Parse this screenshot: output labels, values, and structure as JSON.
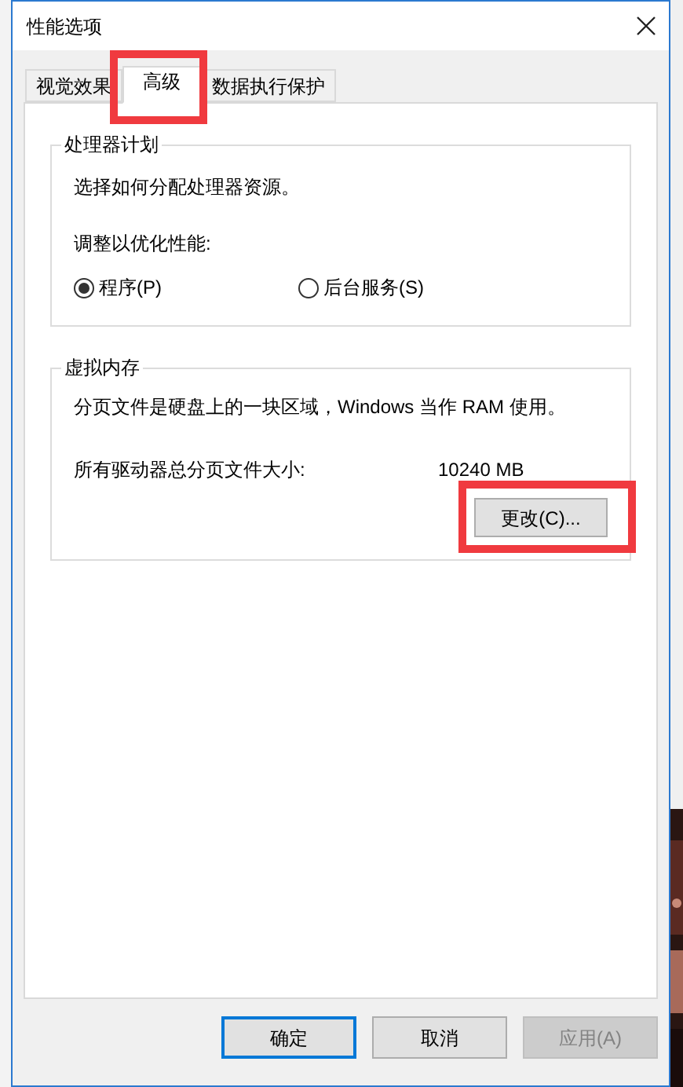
{
  "window": {
    "title": "性能选项"
  },
  "tabs": [
    {
      "label": "视觉效果",
      "selected": false,
      "highlighted": false
    },
    {
      "label": "高级",
      "selected": true,
      "highlighted": true
    },
    {
      "label": "数据执行保护",
      "selected": false,
      "highlighted": false
    }
  ],
  "groups": [
    {
      "kind": "options",
      "title": "处理器计划",
      "description": "选择如何分配处理器资源。",
      "prompt": "调整以优化性能:",
      "options": [
        {
          "label": "程序(P)",
          "selected": true
        },
        {
          "label": "后台服务(S)",
          "selected": false
        }
      ]
    },
    {
      "kind": "memory",
      "title": "虚拟内存",
      "description": "分页文件是硬盘上的一块区域，Windows 当作 RAM 使用。",
      "size_label": "所有驱动器总分页文件大小:",
      "size_value": "10240 MB",
      "button": {
        "label": "更改(C)...",
        "highlighted": true
      }
    }
  ],
  "buttons": [
    {
      "label": "确定",
      "default": true,
      "disabled": false
    },
    {
      "label": "取消",
      "default": false,
      "disabled": false
    },
    {
      "label": "应用(A)",
      "default": false,
      "disabled": true
    }
  ]
}
